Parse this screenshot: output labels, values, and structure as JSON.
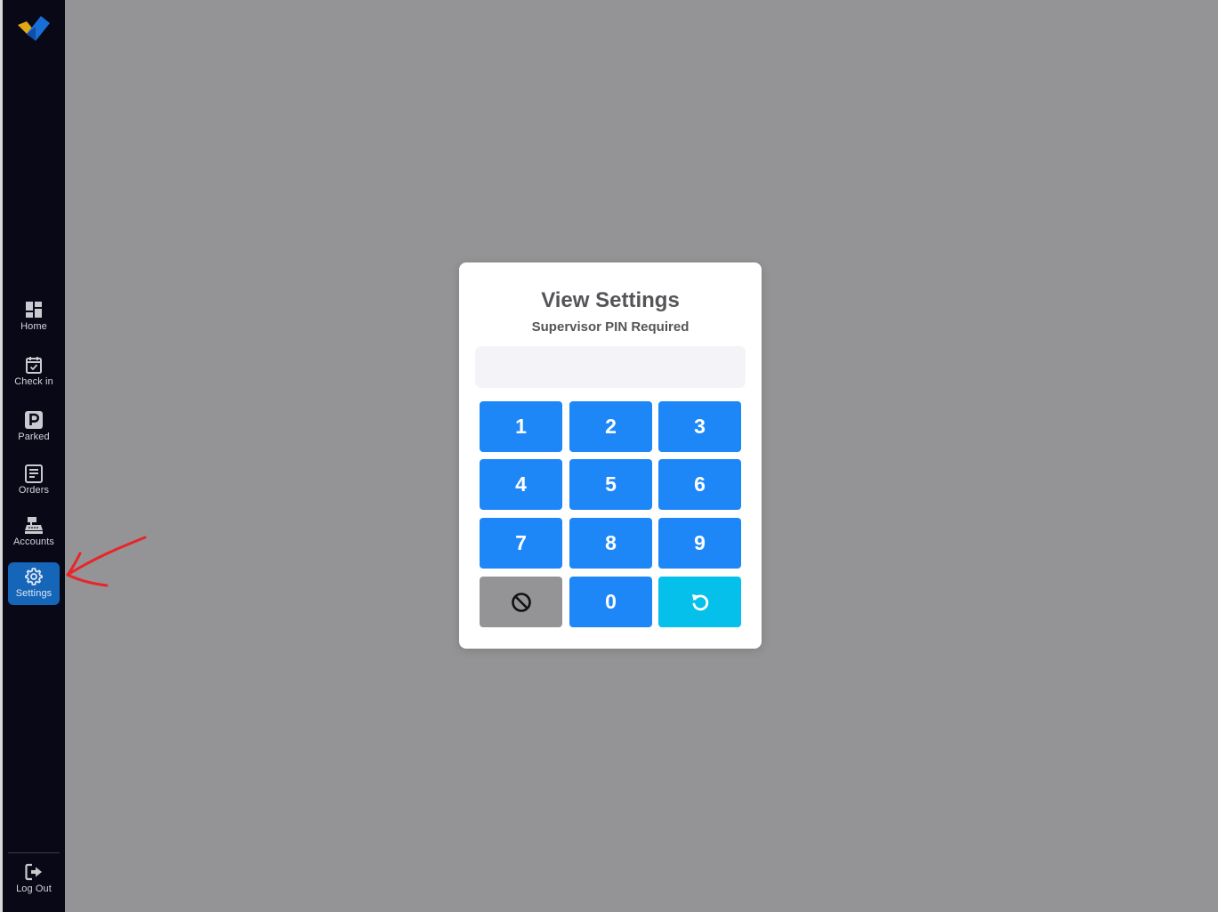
{
  "sidebar": {
    "items": [
      {
        "label": "Home",
        "icon": "dashboard-icon"
      },
      {
        "label": "Check in",
        "icon": "calendar-check-icon"
      },
      {
        "label": "Parked",
        "icon": "parking-icon"
      },
      {
        "label": "Orders",
        "icon": "receipt-icon"
      },
      {
        "label": "Accounts",
        "icon": "cash-register-icon"
      },
      {
        "label": "Settings",
        "icon": "gear-icon",
        "active": true
      }
    ],
    "logout": {
      "label": "Log Out",
      "icon": "logout-icon"
    }
  },
  "modal": {
    "title": "View Settings",
    "subtitle": "Supervisor PIN Required",
    "pin_value": "",
    "keys": [
      "1",
      "2",
      "3",
      "4",
      "5",
      "6",
      "7",
      "8",
      "9",
      "0"
    ],
    "clear_icon": "ban-icon",
    "reset_icon": "undo-icon"
  },
  "colors": {
    "sidebar_bg": "#090817",
    "active_bg": "#1565b8",
    "overlay": "#949496",
    "key_blue": "#1e87f8",
    "key_gray": "#949496",
    "key_cyan": "#05c0ea",
    "annotation": "#e8252a"
  }
}
